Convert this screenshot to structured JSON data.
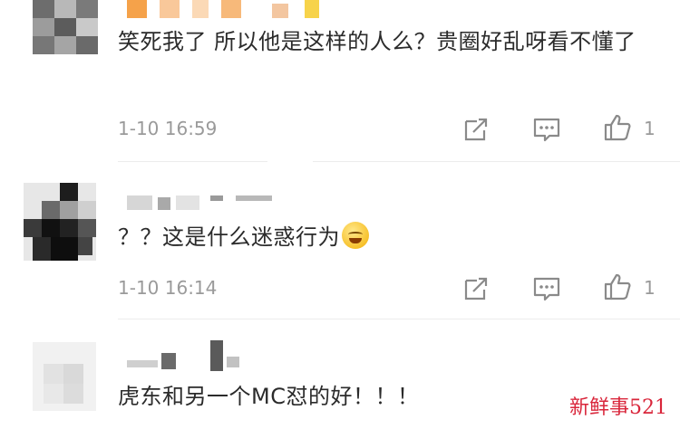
{
  "comments": [
    {
      "text": "笑死我了 所以他是这样的人么？贵圈好乱呀看不懂了",
      "time": "1-10 16:59",
      "likes": "1"
    },
    {
      "text": "？？这是什么迷惑行为",
      "emoji": "smiling-sweat-emoji",
      "time": "1-10 16:14",
      "likes": "1"
    },
    {
      "text": "虎东和另一个MC怼的好！！！"
    }
  ],
  "icons": {
    "share": "share-icon",
    "reply": "comment-icon",
    "like": "thumbs-up-icon"
  },
  "colors": {
    "meta_gray": "#9a9a9a",
    "watermark_red": "#d9263b"
  },
  "watermark": "新鲜事521"
}
